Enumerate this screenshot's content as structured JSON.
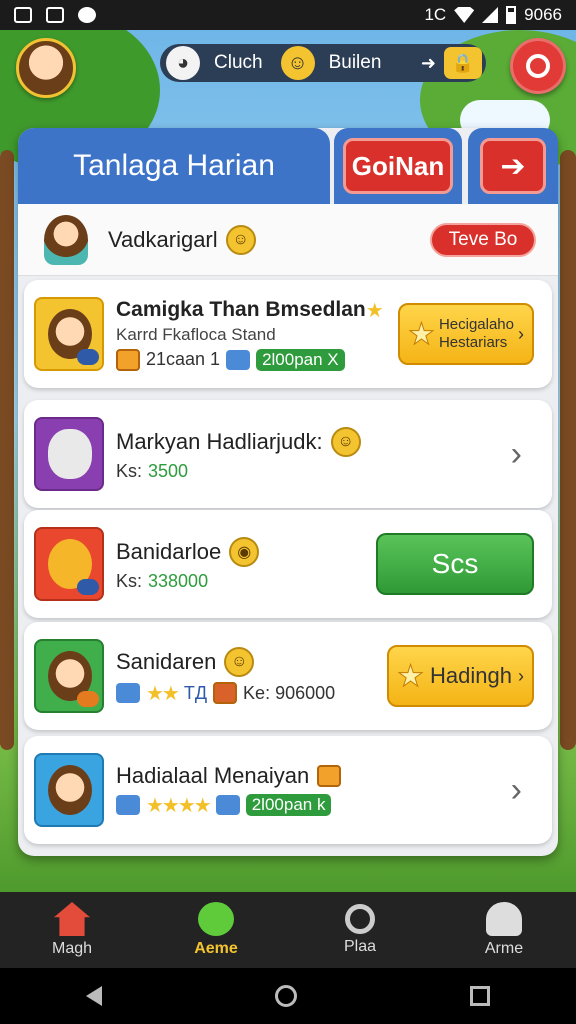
{
  "status_bar": {
    "time": "9066",
    "signal_label": "1C"
  },
  "hud": {
    "left_label": "Cluch",
    "right_label": "Builen",
    "arrow": "➜",
    "lock": "🔒"
  },
  "panel": {
    "title": "Tanlaga Harian",
    "primary_button": "GoiNan",
    "next_button": "➔",
    "header": {
      "name": "Vadkarigarl",
      "button": "Teve Bo"
    }
  },
  "cards": [
    {
      "title": "Camigka Than Bmsedlan",
      "subtitle": "Karrd Fkafloca Stand",
      "meta_text": "21caan 1",
      "pill": "2l00pan X",
      "button_line1": "Hecigalaho",
      "button_line2": "Hestariars"
    },
    {
      "title": "Markyan Hadliarjudk:",
      "value_label": "Ks:",
      "value": "3500"
    },
    {
      "title": "Banidarloe",
      "value_label": "Ks:",
      "value": "338000",
      "button": "Scs"
    },
    {
      "title": "Sanidaren",
      "tag_text": "TД",
      "value_text": "Ke: 906000",
      "button": "Hadingh"
    },
    {
      "title": "Hadialaal Menaiyan",
      "pill": "2l00pan k"
    }
  ],
  "nav": [
    {
      "label": "Magh",
      "icon": "home-icon"
    },
    {
      "label": "Aeme",
      "icon": "chat-icon"
    },
    {
      "label": "Plaa",
      "icon": "search-icon"
    },
    {
      "label": "Arme",
      "icon": "user-icon"
    }
  ],
  "colors": {
    "primary_blue": "#3d74c8",
    "accent_red": "#d9302c",
    "accent_yellow": "#f4c430",
    "accent_green": "#2e9c3c"
  }
}
